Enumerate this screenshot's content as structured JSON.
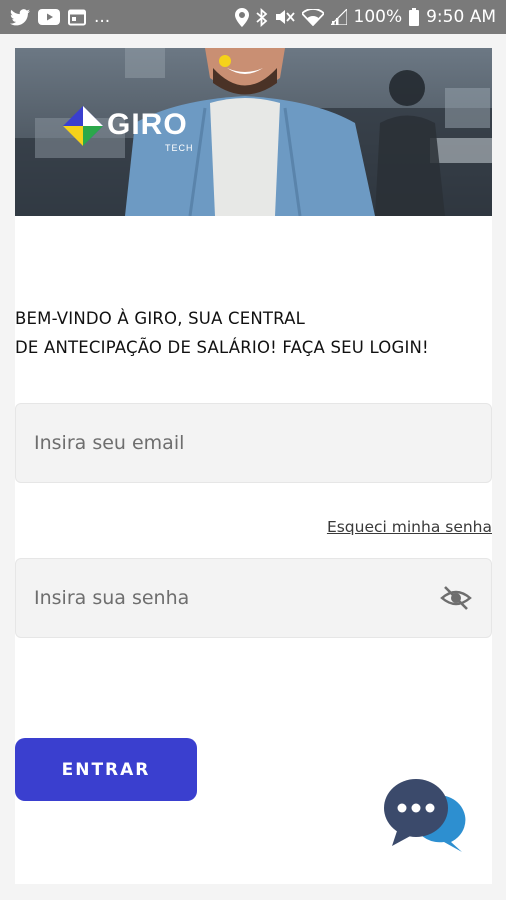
{
  "status_bar": {
    "left_ellipsis": "...",
    "battery": "100%",
    "time": "9:50 AM",
    "left_icons": [
      "twitter-icon",
      "youtube-icon",
      "calendar-icon"
    ],
    "right_icons": [
      "location-icon",
      "bluetooth-icon",
      "mute-icon",
      "wifi-icon",
      "signal-icon",
      "battery-icon"
    ]
  },
  "hero": {
    "logo_text": "GIRO",
    "logo_subtext": "TECH"
  },
  "welcome": {
    "line1": "BEM-VINDO À GIRO, SUA CENTRAL",
    "line2": "DE ANTECIPAÇÃO DE SALÁRIO! FAÇA SEU LOGIN!"
  },
  "form": {
    "email_placeholder": "Insira seu email",
    "forgot_password": "Esqueci minha senha",
    "password_placeholder": "Insira sua senha",
    "submit_label": "ENTRAR"
  },
  "colors": {
    "primary": "#3a3fcf",
    "chat_dark": "#3b4a6b",
    "chat_light": "#2d8fd0",
    "status_bar": "#7a7a7a"
  }
}
